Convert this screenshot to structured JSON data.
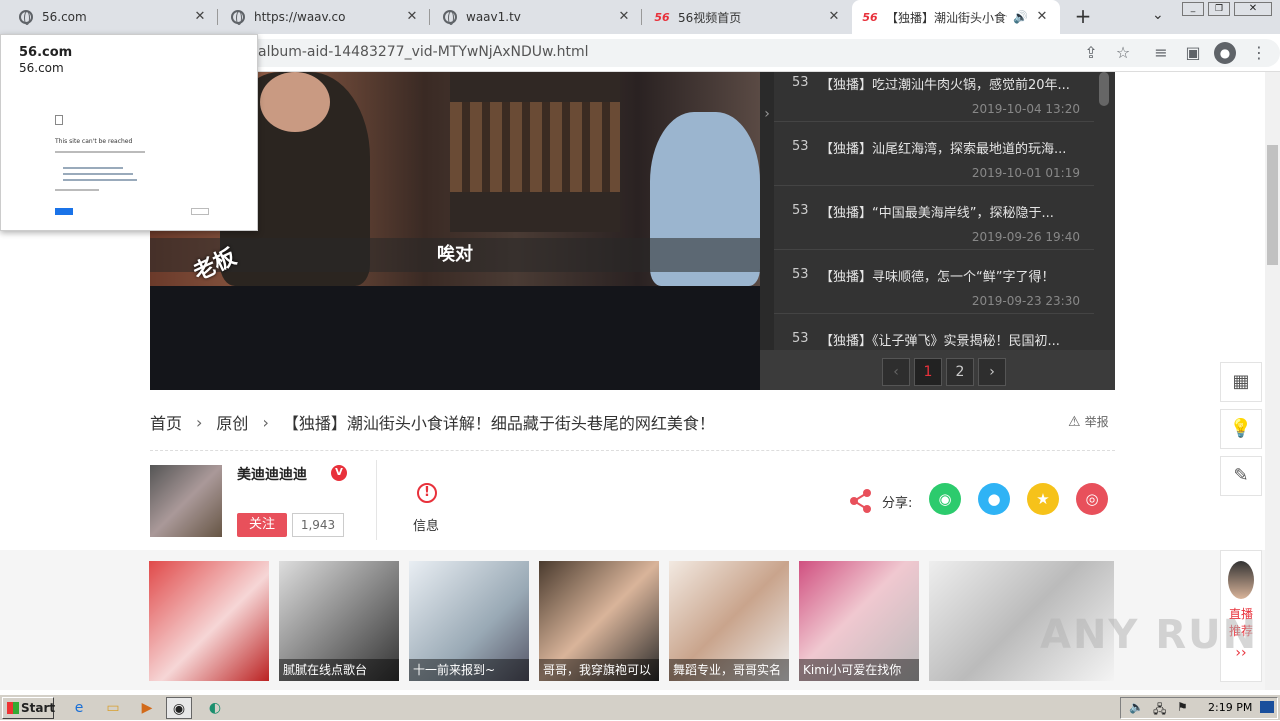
{
  "browser": {
    "tabs": [
      {
        "title": "56.com",
        "active": false
      },
      {
        "title": "https://waav.co",
        "active": false
      },
      {
        "title": "waav1.tv",
        "active": false
      },
      {
        "title": "56视频首页",
        "active": false
      },
      {
        "title": "【独播】潮汕街头小食详解",
        "active": true
      }
    ],
    "new_tab": "+",
    "url": "album-aid-14483277_vid-MTYwNjAxNDUw.html"
  },
  "popup": {
    "title": "56.com",
    "subtitle": "56.com",
    "error_heading": "This site can't be reached"
  },
  "video": {
    "subtitle": "唉对",
    "stamp": "老板"
  },
  "playlist": {
    "items": [
      {
        "num": "53",
        "title": "【独播】吃过潮汕牛肉火锅，感觉前20年...",
        "date": "2019-10-04 13:20"
      },
      {
        "num": "53",
        "title": "【独播】汕尾红海湾，探索最地道的玩海...",
        "date": "2019-10-01 01:19"
      },
      {
        "num": "53",
        "title": "【独播】“中国最美海岸线”，探秘隐于...",
        "date": "2019-09-26 19:40"
      },
      {
        "num": "53",
        "title": "【独播】寻味顺德，怎一个“鲜”字了得！",
        "date": "2019-09-23 23:30"
      },
      {
        "num": "53",
        "title": "【独播】《让子弹飞》实景揭秘！民国初...",
        "date": ""
      }
    ],
    "pager": {
      "prev": "‹",
      "pages": [
        "1",
        "2"
      ],
      "next": "›"
    }
  },
  "breadcrumb": {
    "home": "首页",
    "category": "原创",
    "title": "【独播】潮汕街头小食详解！细品藏于街头巷尾的网红美食！"
  },
  "report_label": "举报",
  "author": {
    "name": "美迪迪迪迪",
    "badge": "V",
    "follow_label": "关注",
    "fans": "1,943"
  },
  "info_label": "信息",
  "share": {
    "label": "分享:"
  },
  "live": {
    "line1": "直播",
    "line2": "推荐",
    "arrow": "››"
  },
  "thumbs": [
    {
      "caption": ""
    },
    {
      "caption": "腻腻在线点歌台"
    },
    {
      "caption": "十一前来报到~"
    },
    {
      "caption": "哥哥，我穿旗袍可以"
    },
    {
      "caption": "舞蹈专业，哥哥实名"
    },
    {
      "caption": "Kimi小可爱在找你"
    },
    {
      "caption": ""
    }
  ],
  "watermark": "ANY RUN",
  "taskbar": {
    "start": "Start",
    "clock": "2:19 PM"
  }
}
